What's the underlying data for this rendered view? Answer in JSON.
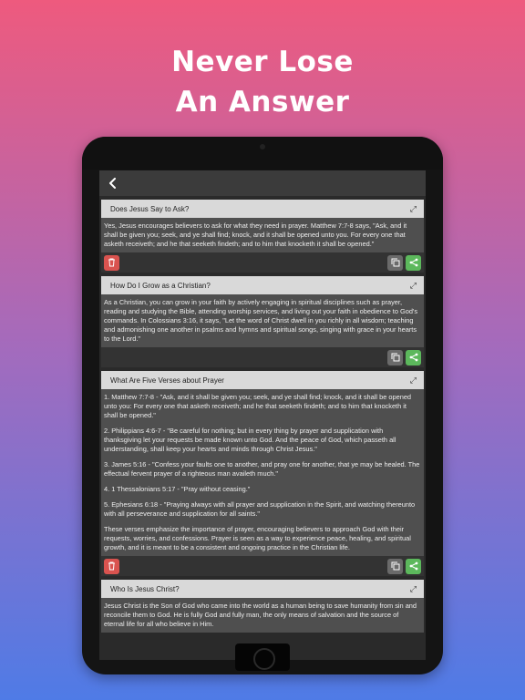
{
  "headline": {
    "line1": "Never Lose",
    "line2": "An Answer"
  },
  "cards": [
    {
      "title": "Does Jesus Say to Ask?",
      "paragraphs": [
        "Yes, Jesus encourages believers to ask for what they need in prayer. Matthew 7:7-8 says, \"Ask, and it shall be given you; seek, and ye shall find; knock, and it shall be opened unto you. For every one that asketh receiveth; and he that seeketh findeth; and to him that knocketh it shall be opened.\""
      ]
    },
    {
      "title": "How Do I Grow as a Christian?",
      "paragraphs": [
        "As a Christian, you can grow in your faith by actively engaging in spiritual disciplines such as prayer, reading and studying the Bible, attending worship services, and living out your faith in obedience to God's commands. In Colossians 3:16, it says, \"Let the word of Christ dwell in you richly in all wisdom; teaching and admonishing one another in psalms and hymns and spiritual songs, singing with grace in your hearts to the Lord.\""
      ]
    },
    {
      "title": "What Are Five Verses about Prayer",
      "paragraphs": [
        "1. Matthew 7:7-8 - \"Ask, and it shall be given you; seek, and ye shall find; knock, and it shall be opened unto you: For every one that asketh receiveth; and he that seeketh findeth; and to him that knocketh it shall be opened.\"",
        "2. Philippians 4:6-7 - \"Be careful for nothing; but in every thing by prayer and supplication with thanksgiving let your requests be made known unto God. And the peace of God, which passeth all understanding, shall keep your hearts and minds through Christ Jesus.\"",
        "3. James 5:16 - \"Confess your faults one to another, and pray one for another, that ye may be healed. The effectual fervent prayer of a righteous man availeth much.\"",
        "4. 1 Thessalonians 5:17 - \"Pray without ceasing.\"",
        "5. Ephesians 6:18 - \"Praying always with all prayer and supplication in the Spirit, and watching thereunto with all perseverance and supplication for all saints.\"",
        "These verses emphasize the importance of prayer, encouraging believers to approach God with their requests, worries, and confessions. Prayer is seen as a way to experience peace, healing, and spiritual growth, and it is meant to be a consistent and ongoing practice in the Christian life."
      ]
    },
    {
      "title": "Who Is Jesus Christ?",
      "paragraphs": [
        "Jesus Christ is the Son of God who came into the world as a human being to save humanity from sin and reconcile them to God. He is fully God and fully man, the only means of salvation and the source of eternal life for all who believe in Him."
      ]
    }
  ],
  "icons": {
    "back": "chevron-left-icon",
    "expand": "expand-arrows-icon",
    "delete": "trash-icon",
    "copy": "copy-icon",
    "share": "share-icon"
  },
  "colors": {
    "gradient_top": "#ee5a7e",
    "gradient_bottom": "#4f7be6",
    "delete": "#d9534f",
    "share": "#5cb85c",
    "copy": "#6a6a6a"
  }
}
